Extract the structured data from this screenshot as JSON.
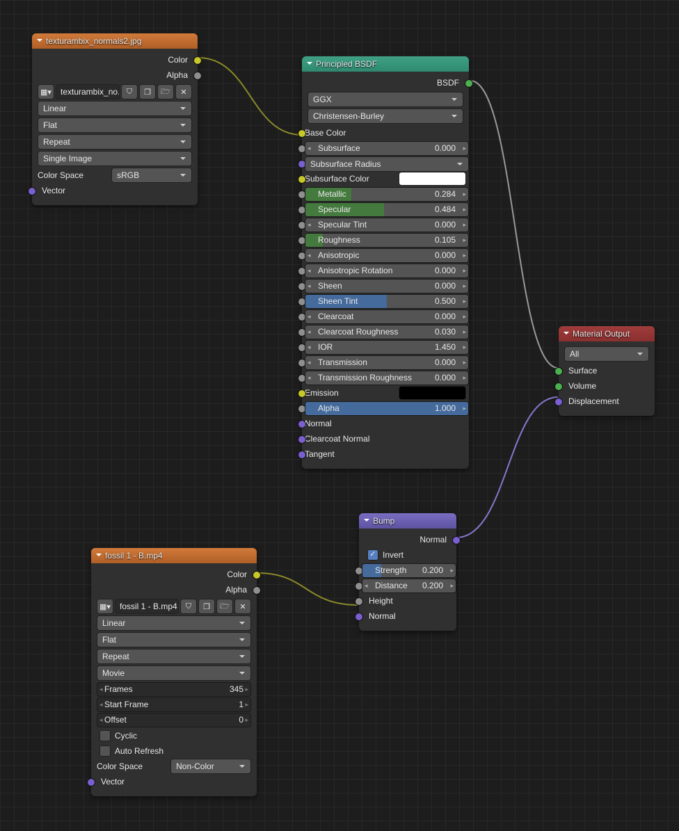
{
  "nodes": {
    "tex1": {
      "title": "texturambix_normals2.jpg",
      "file": "texturambix_no..",
      "interp": "Linear",
      "proj": "Flat",
      "ext": "Repeat",
      "src": "Single Image",
      "cs_lbl": "Color Space",
      "cs": "sRGB",
      "out_color": "Color",
      "out_alpha": "Alpha",
      "in_vec": "Vector"
    },
    "bsdf": {
      "title": "Principled BSDF",
      "out": "BSDF",
      "dist": "GGX",
      "sss": "Christensen-Burley",
      "sockets": [
        {
          "name": "Base Color",
          "type": "label",
          "dot": "c-y"
        },
        {
          "name": "Subsurface",
          "val": "0.000",
          "fill": "",
          "pct": 0,
          "dot": "c-gy"
        },
        {
          "name": "Subsurface Radius",
          "type": "sel",
          "dot": "c-pu"
        },
        {
          "name": "Subsurface Color",
          "type": "swatch",
          "sw": "#fff",
          "dot": "c-y"
        },
        {
          "name": "Metallic",
          "val": "0.284",
          "fill": "f-gn",
          "pct": 28.4,
          "dot": "c-gy"
        },
        {
          "name": "Specular",
          "val": "0.484",
          "fill": "f-gn",
          "pct": 48.4,
          "dot": "c-gy"
        },
        {
          "name": "Specular Tint",
          "val": "0.000",
          "fill": "",
          "pct": 0,
          "dot": "c-gy"
        },
        {
          "name": "Roughness",
          "val": "0.105",
          "fill": "f-gn",
          "pct": 10.5,
          "dot": "c-gy"
        },
        {
          "name": "Anisotropic",
          "val": "0.000",
          "fill": "",
          "pct": 0,
          "dot": "c-gy"
        },
        {
          "name": "Anisotropic Rotation",
          "val": "0.000",
          "fill": "",
          "pct": 0,
          "dot": "c-gy"
        },
        {
          "name": "Sheen",
          "val": "0.000",
          "fill": "",
          "pct": 0,
          "dot": "c-gy"
        },
        {
          "name": "Sheen Tint",
          "val": "0.500",
          "fill": "f-bl",
          "pct": 50,
          "dot": "c-gy"
        },
        {
          "name": "Clearcoat",
          "val": "0.000",
          "fill": "",
          "pct": 0,
          "dot": "c-gy"
        },
        {
          "name": "Clearcoat Roughness",
          "val": "0.030",
          "fill": "",
          "pct": 3,
          "dot": "c-gy"
        },
        {
          "name": "IOR",
          "val": "1.450",
          "type": "num",
          "dot": "c-gy"
        },
        {
          "name": "Transmission",
          "val": "0.000",
          "fill": "",
          "pct": 0,
          "dot": "c-gy"
        },
        {
          "name": "Transmission Roughness",
          "val": "0.000",
          "fill": "",
          "pct": 0,
          "dot": "c-gy"
        },
        {
          "name": "Emission",
          "type": "swatch",
          "sw": "#000",
          "dot": "c-y"
        },
        {
          "name": "Alpha",
          "val": "1.000",
          "fill": "f-bl",
          "pct": 100,
          "dot": "c-gy"
        },
        {
          "name": "Normal",
          "type": "label",
          "dot": "c-pu"
        },
        {
          "name": "Clearcoat Normal",
          "type": "label",
          "dot": "c-pu"
        },
        {
          "name": "Tangent",
          "type": "label",
          "dot": "c-pu"
        }
      ]
    },
    "bump": {
      "title": "Bump",
      "out": "Normal",
      "invert": "Invert",
      "invert_on": true,
      "strength": {
        "name": "Strength",
        "val": "0.200",
        "pct": 20
      },
      "distance": {
        "name": "Distance",
        "val": "0.200"
      },
      "height": "Height",
      "normal": "Normal"
    },
    "tex2": {
      "title": "fossil 1 - B.mp4",
      "file": "fossil 1 - B.mp4",
      "interp": "Linear",
      "proj": "Flat",
      "ext": "Repeat",
      "src": "Movie",
      "frames": {
        "l": "Frames",
        "v": "345"
      },
      "start": {
        "l": "Start Frame",
        "v": "1"
      },
      "offset": {
        "l": "Offset",
        "v": "0"
      },
      "cyclic": "Cyclic",
      "auto": "Auto Refresh",
      "cs_lbl": "Color Space",
      "cs": "Non-Color",
      "out_color": "Color",
      "out_alpha": "Alpha",
      "in_vec": "Vector"
    },
    "mout": {
      "title": "Material Output",
      "tgt": "All",
      "surface": "Surface",
      "volume": "Volume",
      "disp": "Displacement"
    }
  }
}
